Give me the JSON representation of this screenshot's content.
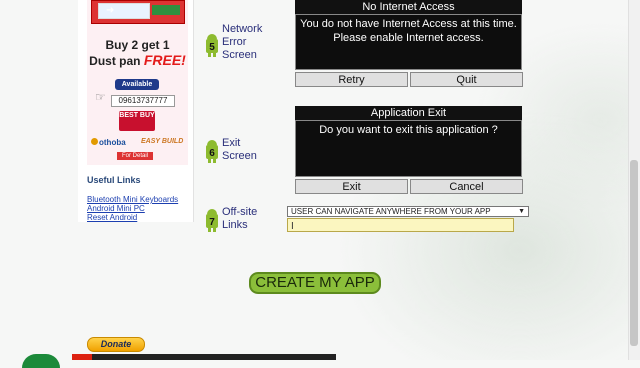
{
  "ad": {
    "line1": "Buy 2 get 1",
    "line2_prefix": "Dust pan",
    "line2_free": "FREE!",
    "available": "Available",
    "phone": "09613737777",
    "bestbuy": "BEST BUY",
    "othoba": "othoba",
    "easybuild": "EASY BUILD",
    "for_detail": "For Detail"
  },
  "useful_links": {
    "title": "Useful Links",
    "items": [
      "Bluetooth Mini Keyboards",
      "Android Mini PC",
      "Reset Android"
    ]
  },
  "steps": [
    {
      "number": "5",
      "label_lines": [
        "Network",
        "Error",
        "Screen"
      ]
    },
    {
      "number": "6",
      "label_lines": [
        "Exit",
        "Screen"
      ]
    },
    {
      "number": "7",
      "label_lines": [
        "Off-site",
        "Links"
      ]
    }
  ],
  "network_dialog": {
    "title": "No Internet Access",
    "message_line1": "You do not have Internet Access at this time.",
    "message_line2": "Please enable Internet access.",
    "retry": "Retry",
    "quit": "Quit"
  },
  "exit_dialog": {
    "title": "Application Exit",
    "message": "Do you want to exit this application ?",
    "exit": "Exit",
    "cancel": "Cancel"
  },
  "offsite": {
    "selected": "USER CAN NAVIGATE ANYWHERE FROM YOUR APP",
    "input_value": ""
  },
  "create_button": "CREATE MY APP",
  "donate_button": "Donate",
  "colors": {
    "create_green": "#8bbf3a",
    "dialog_black": "#0d0d0d",
    "link_blue": "#1c3fb0",
    "label_navy": "#2a2f7a",
    "android_green": "#8dbb2f"
  }
}
